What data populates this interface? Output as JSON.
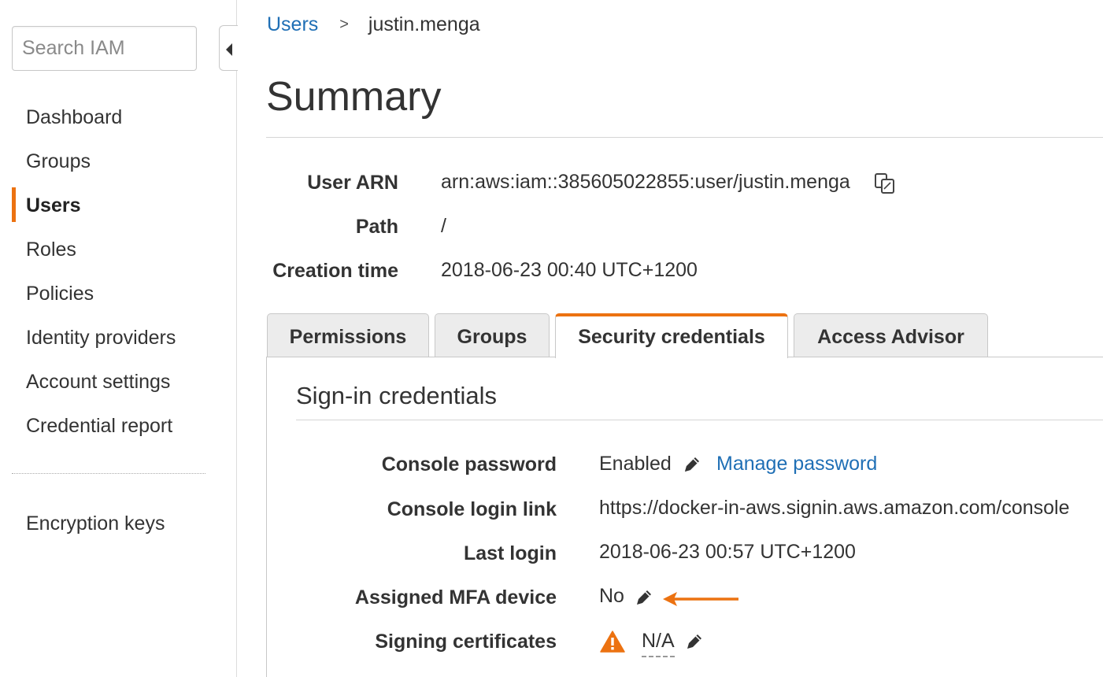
{
  "sidebar": {
    "search_placeholder": "Search IAM",
    "collapse_icon": "caret-left-icon",
    "items": [
      {
        "label": "Dashboard",
        "active": false
      },
      {
        "label": "Groups",
        "active": false
      },
      {
        "label": "Users",
        "active": true
      },
      {
        "label": "Roles",
        "active": false
      },
      {
        "label": "Policies",
        "active": false
      },
      {
        "label": "Identity providers",
        "active": false
      },
      {
        "label": "Account settings",
        "active": false
      },
      {
        "label": "Credential report",
        "active": false
      }
    ],
    "secondary_items": [
      {
        "label": "Encryption keys"
      }
    ]
  },
  "breadcrumb": {
    "parent": "Users",
    "separator": ">",
    "current": "justin.menga"
  },
  "page_title": "Summary",
  "summary": {
    "user_arn_label": "User ARN",
    "user_arn_value": "arn:aws:iam::385605022855:user/justin.menga",
    "path_label": "Path",
    "path_value": "/",
    "creation_time_label": "Creation time",
    "creation_time_value": "2018-06-23 00:40 UTC+1200"
  },
  "tabs": [
    {
      "label": "Permissions",
      "active": false
    },
    {
      "label": "Groups",
      "active": false
    },
    {
      "label": "Security credentials",
      "active": true
    },
    {
      "label": "Access Advisor",
      "active": false
    }
  ],
  "signin": {
    "title": "Sign-in credentials",
    "console_password_label": "Console password",
    "console_password_value": "Enabled",
    "manage_password_link": "Manage password",
    "console_login_link_label": "Console login link",
    "console_login_link_value": "https://docker-in-aws.signin.aws.amazon.com/console",
    "last_login_label": "Last login",
    "last_login_value": "2018-06-23 00:57 UTC+1200",
    "mfa_label": "Assigned MFA device",
    "mfa_value": "No",
    "signing_cert_label": "Signing certificates",
    "signing_cert_value": "N/A"
  },
  "colors": {
    "accent": "#ec7211",
    "link": "#1f6fb5",
    "warning": "#ec7211"
  }
}
